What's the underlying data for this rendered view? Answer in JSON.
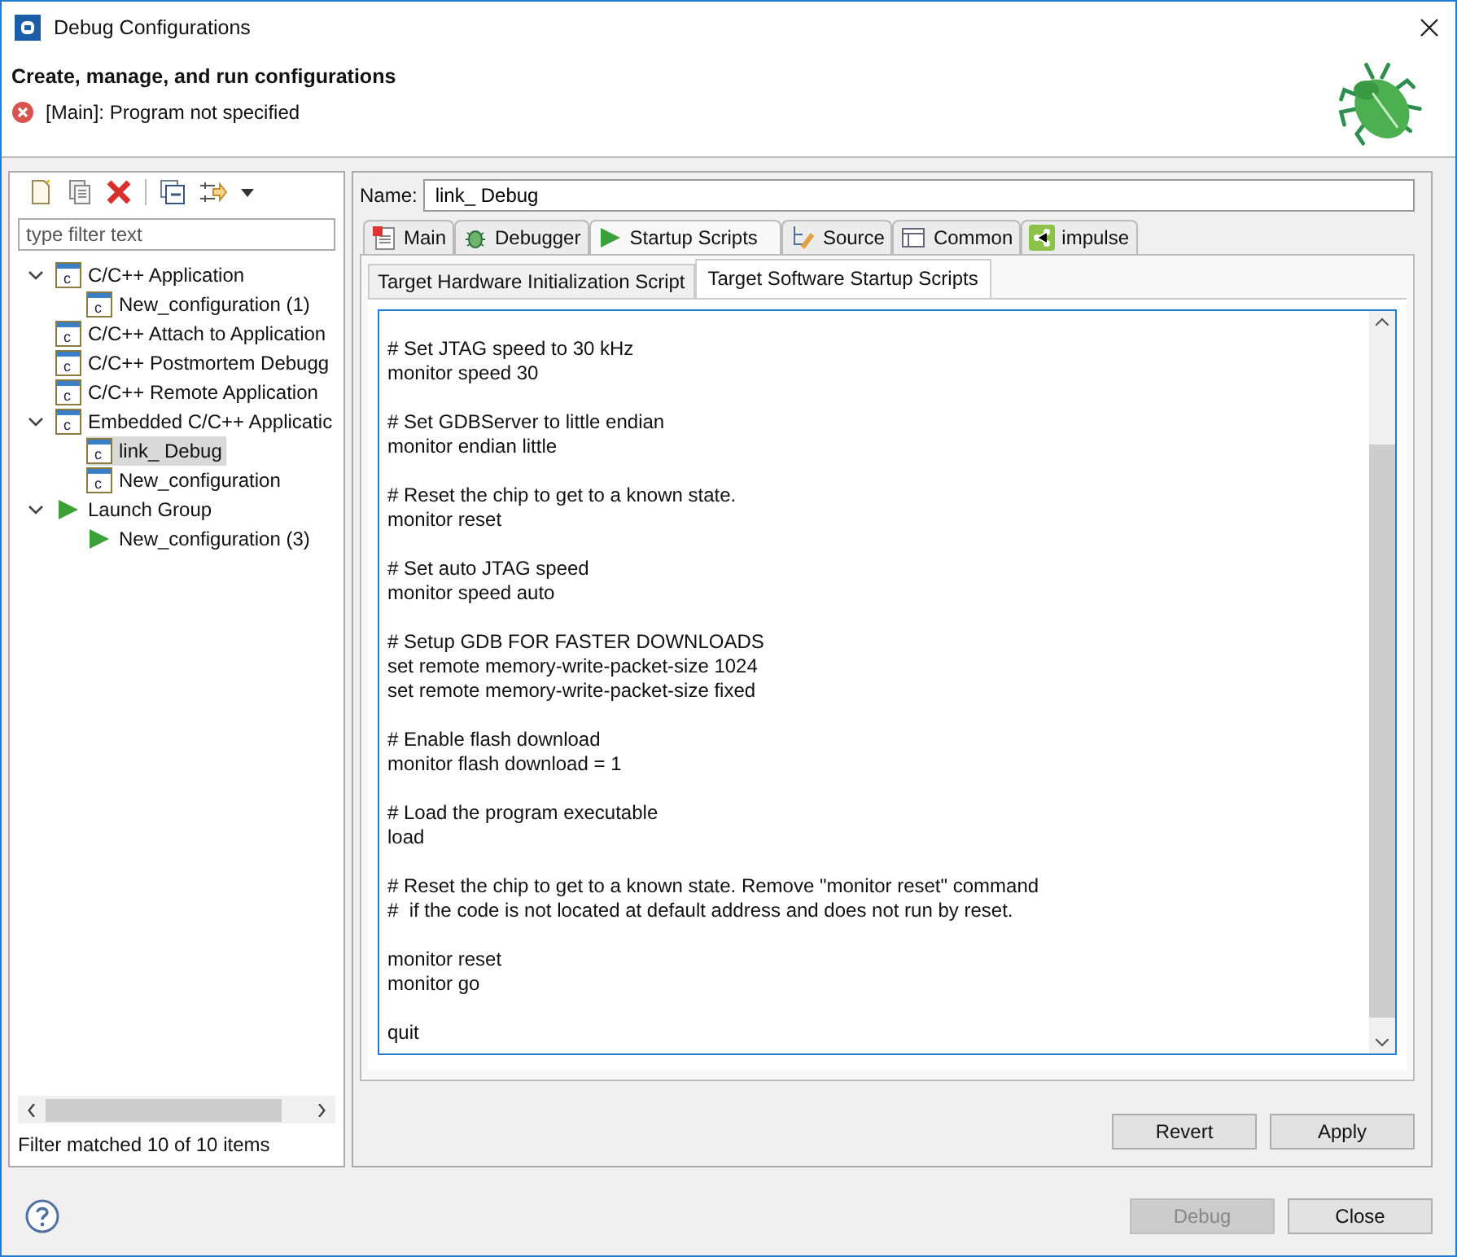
{
  "window": {
    "title": "Debug Configurations"
  },
  "header": {
    "title": "Create, manage, and run configurations",
    "message": "[Main]: Program not specified"
  },
  "sidebar": {
    "filter_placeholder": "type filter text",
    "tree": [
      {
        "label": "C/C++ Application",
        "kind": "c",
        "expanded": true,
        "selected": false,
        "children": [
          {
            "label": "New_configuration (1)",
            "kind": "c",
            "selected": false
          }
        ]
      },
      {
        "label": "C/C++ Attach to Application",
        "kind": "c",
        "selected": false
      },
      {
        "label": "C/C++ Postmortem Debugg",
        "kind": "c",
        "selected": false
      },
      {
        "label": "C/C++ Remote Application",
        "kind": "c",
        "selected": false
      },
      {
        "label": "Embedded C/C++ Applicatic",
        "kind": "c",
        "expanded": true,
        "selected": false,
        "children": [
          {
            "label": "link_ Debug",
            "kind": "c",
            "selected": true
          },
          {
            "label": "New_configuration",
            "kind": "c",
            "selected": false
          }
        ]
      },
      {
        "label": "Launch Group",
        "kind": "launch",
        "expanded": true,
        "selected": false,
        "children": [
          {
            "label": "New_configuration (3)",
            "kind": "launch",
            "selected": false
          }
        ]
      }
    ],
    "status": "Filter matched 10 of 10 items"
  },
  "name_field": {
    "label": "Name:",
    "value": "link_ Debug"
  },
  "tabs": [
    {
      "label": "Main",
      "kind": "main",
      "selected": false
    },
    {
      "label": "Debugger",
      "kind": "bug",
      "selected": false
    },
    {
      "label": "Startup Scripts",
      "kind": "run",
      "selected": true
    },
    {
      "label": "Source",
      "kind": "source",
      "selected": false
    },
    {
      "label": "Common",
      "kind": "common",
      "selected": false
    },
    {
      "label": "impulse",
      "kind": "share",
      "selected": false
    }
  ],
  "subtabs": [
    {
      "label": "Target Hardware Initialization Script",
      "selected": false
    },
    {
      "label": "Target Software Startup Scripts",
      "selected": true
    }
  ],
  "script_blocks": [
    [
      "# Set JTAG speed to 30 kHz",
      "monitor speed 30"
    ],
    [
      "# Set GDBServer to little endian",
      "monitor endian little"
    ],
    [
      "# Reset the chip to get to a known state.",
      "monitor reset"
    ],
    [
      "# Set auto JTAG speed",
      "monitor speed auto"
    ],
    [
      "# Setup GDB FOR FASTER DOWNLOADS",
      "set remote memory-write-packet-size 1024",
      "set remote memory-write-packet-size fixed"
    ],
    [
      "# Enable flash download",
      "monitor flash download = 1"
    ],
    [
      "# Load the program executable",
      "load"
    ],
    [
      "# Reset the chip to get to a known state. Remove \"monitor reset\" command",
      "#  if the code is not located at default address and does not run by reset."
    ],
    [
      "monitor reset",
      "monitor go"
    ],
    [
      "quit"
    ]
  ],
  "panel_buttons": [
    {
      "label": "Revert",
      "disabled": false
    },
    {
      "label": "Apply",
      "disabled": false
    }
  ],
  "dialog_buttons": [
    {
      "label": "Debug",
      "disabled": true
    },
    {
      "label": "Close",
      "disabled": false
    }
  ]
}
